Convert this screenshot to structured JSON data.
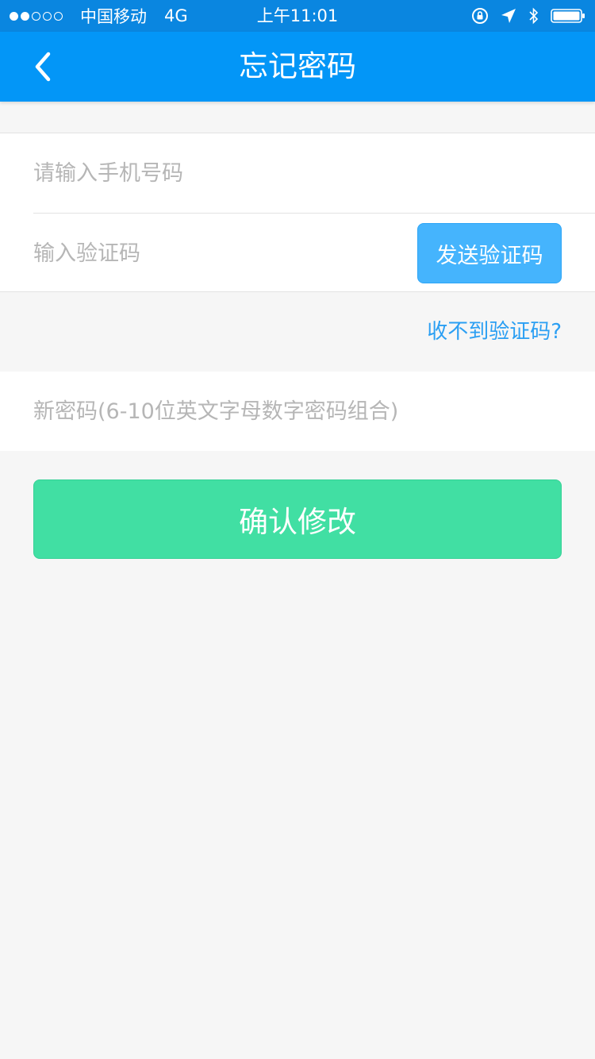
{
  "status_bar": {
    "carrier": "中国移动",
    "network": "4G",
    "time": "上午11:01",
    "signal_bars_filled": 2,
    "signal_bars_total": 5,
    "icons": [
      "orientation-lock-icon",
      "location-icon",
      "bluetooth-icon",
      "battery-icon"
    ]
  },
  "nav": {
    "title": "忘记密码",
    "back_icon": "chevron-left-icon"
  },
  "form": {
    "phone_placeholder": "请输入手机号码",
    "code_placeholder": "输入验证码",
    "send_code_label": "发送验证码",
    "no_code_link": "收不到验证码?",
    "new_password_placeholder": "新密码(6-10位英文字母数字密码组合)",
    "confirm_label": "确认修改"
  },
  "colors": {
    "status_bar_bg": "#0a86e0",
    "nav_bg": "#0396f7",
    "send_button_bg": "#45b4fd",
    "link": "#2b9ff3",
    "confirm_button_bg": "#41dfa3",
    "page_bg": "#f6f6f6",
    "placeholder": "#b6b6b6"
  }
}
